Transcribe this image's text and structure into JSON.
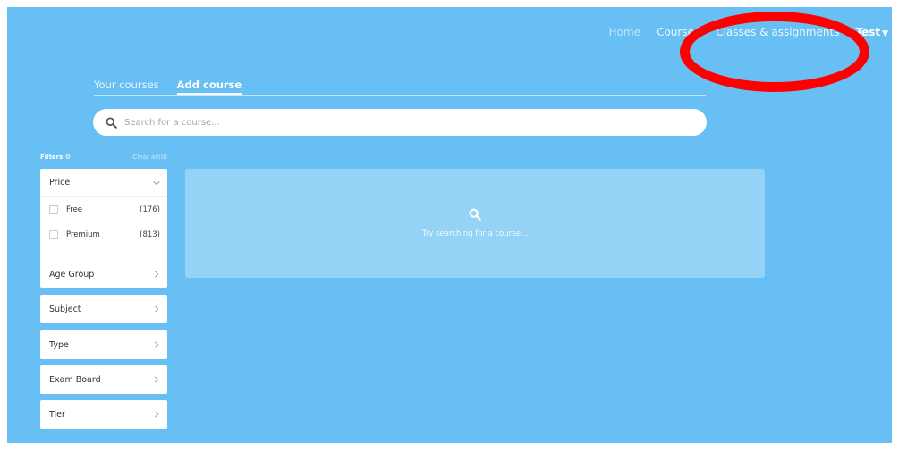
{
  "nav": {
    "home": "Home",
    "courses": "Courses",
    "classes": "Classes & assignments",
    "user": "Test"
  },
  "tabs": [
    {
      "label": "Your courses",
      "active": false
    },
    {
      "label": "Add course",
      "active": true
    }
  ],
  "search": {
    "placeholder": "Search for a course..."
  },
  "filters": {
    "title": "Filters",
    "clear": "Clear all(0)",
    "price": {
      "label": "Price",
      "options": [
        {
          "label": "Free",
          "count": "(176)"
        },
        {
          "label": "Premium",
          "count": "(813)"
        }
      ]
    },
    "groups": [
      "Age Group",
      "Subject",
      "Type",
      "Exam Board",
      "Tier"
    ]
  },
  "results": {
    "hint": "Try searching for a course..."
  },
  "colors": {
    "background": "#67bff3",
    "panel": "#94d3f6",
    "annotation": "#ff0000"
  }
}
